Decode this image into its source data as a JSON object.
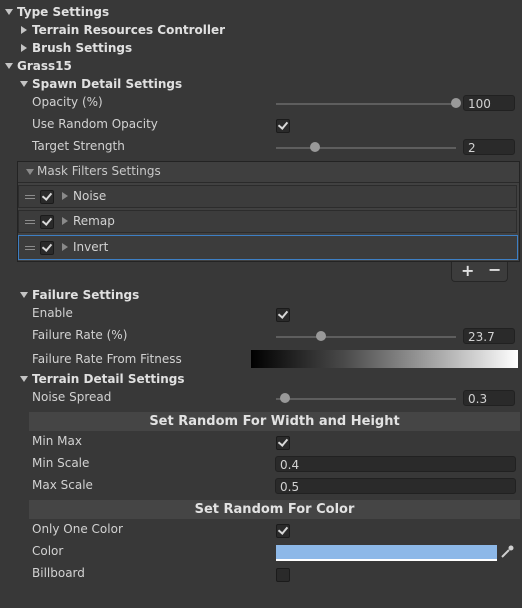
{
  "sections": {
    "type_settings": "Type Settings",
    "terrain_resources": "Terrain Resources Controller",
    "brush_settings": "Brush Settings",
    "grass": "Grass15",
    "spawn_detail": "Spawn Detail Settings"
  },
  "spawn": {
    "opacity_label": "Opacity (%)",
    "opacity_value": "100",
    "opacity_fraction": 1.0,
    "random_opacity_label": "Use Random Opacity",
    "random_opacity_checked": true,
    "target_strength_label": "Target Strength",
    "target_strength_value": "2",
    "target_strength_fraction": 0.2
  },
  "mask": {
    "header": "Mask Filters Settings",
    "items": [
      {
        "label": "Noise",
        "checked": true
      },
      {
        "label": "Remap",
        "checked": true
      },
      {
        "label": "Invert",
        "checked": true
      }
    ],
    "add": "+",
    "remove": "−"
  },
  "failure": {
    "title": "Failure Settings",
    "enable_label": "Enable",
    "enable_checked": true,
    "rate_label": "Failure Rate (%)",
    "rate_value": "23.7",
    "rate_fraction": 0.237,
    "fitness_label": "Failure Rate From Fitness"
  },
  "terrain_detail": {
    "title": "Terrain Detail Settings",
    "noise_label": "Noise Spread",
    "noise_value": "0.3",
    "noise_fraction": 0.05,
    "wh_bar": "Set Random For Width and Height",
    "minmax_label": "Min Max",
    "minmax_checked": true,
    "min_scale_label": "Min Scale",
    "min_scale_value": "0.4",
    "max_scale_label": "Max Scale",
    "max_scale_value": "0.5",
    "color_bar": "Set Random For Color",
    "one_color_label": "Only One Color",
    "one_color_checked": true,
    "color_label": "Color",
    "color_value": "#8db8e8",
    "billboard_label": "Billboard",
    "billboard_checked": false
  }
}
